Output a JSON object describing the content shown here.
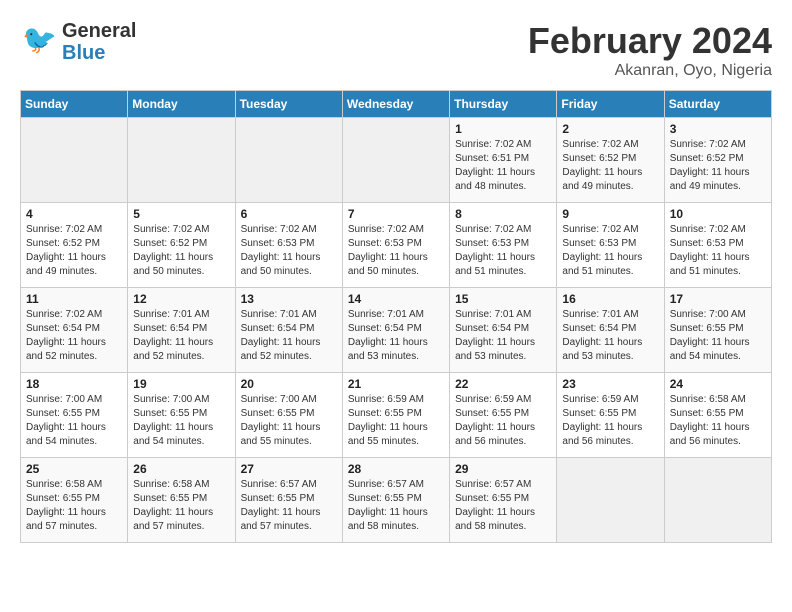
{
  "header": {
    "logo_general": "General",
    "logo_blue": "Blue",
    "title": "February 2024",
    "subtitle": "Akanran, Oyo, Nigeria"
  },
  "days_of_week": [
    "Sunday",
    "Monday",
    "Tuesday",
    "Wednesday",
    "Thursday",
    "Friday",
    "Saturday"
  ],
  "weeks": [
    [
      {
        "day": "",
        "info": ""
      },
      {
        "day": "",
        "info": ""
      },
      {
        "day": "",
        "info": ""
      },
      {
        "day": "",
        "info": ""
      },
      {
        "day": "1",
        "info": "Sunrise: 7:02 AM\nSunset: 6:51 PM\nDaylight: 11 hours and 48 minutes."
      },
      {
        "day": "2",
        "info": "Sunrise: 7:02 AM\nSunset: 6:52 PM\nDaylight: 11 hours and 49 minutes."
      },
      {
        "day": "3",
        "info": "Sunrise: 7:02 AM\nSunset: 6:52 PM\nDaylight: 11 hours and 49 minutes."
      }
    ],
    [
      {
        "day": "4",
        "info": "Sunrise: 7:02 AM\nSunset: 6:52 PM\nDaylight: 11 hours and 49 minutes."
      },
      {
        "day": "5",
        "info": "Sunrise: 7:02 AM\nSunset: 6:52 PM\nDaylight: 11 hours and 50 minutes."
      },
      {
        "day": "6",
        "info": "Sunrise: 7:02 AM\nSunset: 6:53 PM\nDaylight: 11 hours and 50 minutes."
      },
      {
        "day": "7",
        "info": "Sunrise: 7:02 AM\nSunset: 6:53 PM\nDaylight: 11 hours and 50 minutes."
      },
      {
        "day": "8",
        "info": "Sunrise: 7:02 AM\nSunset: 6:53 PM\nDaylight: 11 hours and 51 minutes."
      },
      {
        "day": "9",
        "info": "Sunrise: 7:02 AM\nSunset: 6:53 PM\nDaylight: 11 hours and 51 minutes."
      },
      {
        "day": "10",
        "info": "Sunrise: 7:02 AM\nSunset: 6:53 PM\nDaylight: 11 hours and 51 minutes."
      }
    ],
    [
      {
        "day": "11",
        "info": "Sunrise: 7:02 AM\nSunset: 6:54 PM\nDaylight: 11 hours and 52 minutes."
      },
      {
        "day": "12",
        "info": "Sunrise: 7:01 AM\nSunset: 6:54 PM\nDaylight: 11 hours and 52 minutes."
      },
      {
        "day": "13",
        "info": "Sunrise: 7:01 AM\nSunset: 6:54 PM\nDaylight: 11 hours and 52 minutes."
      },
      {
        "day": "14",
        "info": "Sunrise: 7:01 AM\nSunset: 6:54 PM\nDaylight: 11 hours and 53 minutes."
      },
      {
        "day": "15",
        "info": "Sunrise: 7:01 AM\nSunset: 6:54 PM\nDaylight: 11 hours and 53 minutes."
      },
      {
        "day": "16",
        "info": "Sunrise: 7:01 AM\nSunset: 6:54 PM\nDaylight: 11 hours and 53 minutes."
      },
      {
        "day": "17",
        "info": "Sunrise: 7:00 AM\nSunset: 6:55 PM\nDaylight: 11 hours and 54 minutes."
      }
    ],
    [
      {
        "day": "18",
        "info": "Sunrise: 7:00 AM\nSunset: 6:55 PM\nDaylight: 11 hours and 54 minutes."
      },
      {
        "day": "19",
        "info": "Sunrise: 7:00 AM\nSunset: 6:55 PM\nDaylight: 11 hours and 54 minutes."
      },
      {
        "day": "20",
        "info": "Sunrise: 7:00 AM\nSunset: 6:55 PM\nDaylight: 11 hours and 55 minutes."
      },
      {
        "day": "21",
        "info": "Sunrise: 6:59 AM\nSunset: 6:55 PM\nDaylight: 11 hours and 55 minutes."
      },
      {
        "day": "22",
        "info": "Sunrise: 6:59 AM\nSunset: 6:55 PM\nDaylight: 11 hours and 56 minutes."
      },
      {
        "day": "23",
        "info": "Sunrise: 6:59 AM\nSunset: 6:55 PM\nDaylight: 11 hours and 56 minutes."
      },
      {
        "day": "24",
        "info": "Sunrise: 6:58 AM\nSunset: 6:55 PM\nDaylight: 11 hours and 56 minutes."
      }
    ],
    [
      {
        "day": "25",
        "info": "Sunrise: 6:58 AM\nSunset: 6:55 PM\nDaylight: 11 hours and 57 minutes."
      },
      {
        "day": "26",
        "info": "Sunrise: 6:58 AM\nSunset: 6:55 PM\nDaylight: 11 hours and 57 minutes."
      },
      {
        "day": "27",
        "info": "Sunrise: 6:57 AM\nSunset: 6:55 PM\nDaylight: 11 hours and 57 minutes."
      },
      {
        "day": "28",
        "info": "Sunrise: 6:57 AM\nSunset: 6:55 PM\nDaylight: 11 hours and 58 minutes."
      },
      {
        "day": "29",
        "info": "Sunrise: 6:57 AM\nSunset: 6:55 PM\nDaylight: 11 hours and 58 minutes."
      },
      {
        "day": "",
        "info": ""
      },
      {
        "day": "",
        "info": ""
      }
    ]
  ]
}
